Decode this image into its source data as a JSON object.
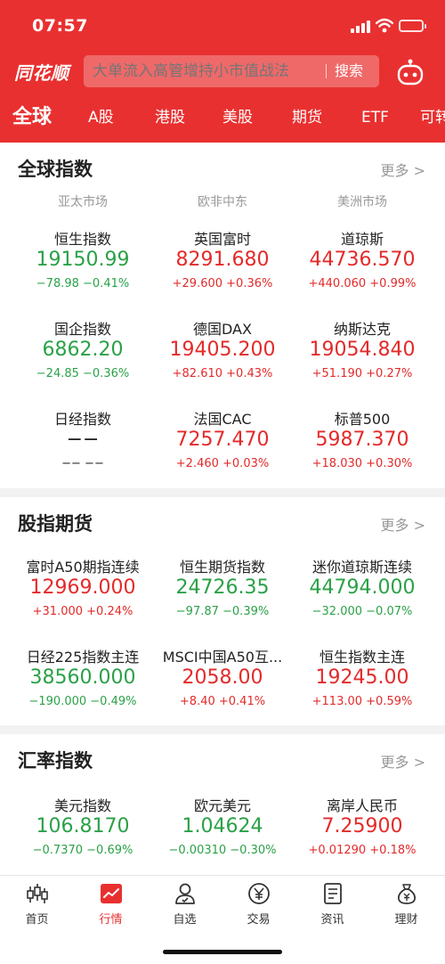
{
  "status": {
    "time": "07:57"
  },
  "header": {
    "logo": "同花顺",
    "search_placeholder": "大单流入高管增持小市值战法",
    "search_button": "搜索"
  },
  "tabs": [
    "全球",
    "A股",
    "港股",
    "美股",
    "期货",
    "ETF",
    "可转"
  ],
  "global": {
    "title": "全球指数",
    "more": "更多",
    "regions": [
      "亚太市场",
      "欧非中东",
      "美洲市场"
    ],
    "items": [
      {
        "name": "恒生指数",
        "price": "19150.99",
        "change": "−78.98  −0.41%",
        "dir": "green"
      },
      {
        "name": "英国富时",
        "price": "8291.680",
        "change": "+29.600  +0.36%",
        "dir": "red"
      },
      {
        "name": "道琼斯",
        "price": "44736.570",
        "change": "+440.060  +0.99%",
        "dir": "red"
      },
      {
        "name": "国企指数",
        "price": "6862.20",
        "change": "−24.85  −0.36%",
        "dir": "green"
      },
      {
        "name": "德国DAX",
        "price": "19405.200",
        "change": "+82.610  +0.43%",
        "dir": "red"
      },
      {
        "name": "纳斯达克",
        "price": "19054.840",
        "change": "+51.190  +0.27%",
        "dir": "red"
      },
      {
        "name": "日经指数",
        "price": "−−",
        "change": "−− −−",
        "dir": "neutral"
      },
      {
        "name": "法国CAC",
        "price": "7257.470",
        "change": "+2.460  +0.03%",
        "dir": "red"
      },
      {
        "name": "标普500",
        "price": "5987.370",
        "change": "+18.030  +0.30%",
        "dir": "red"
      }
    ]
  },
  "futures": {
    "title": "股指期货",
    "more": "更多",
    "items": [
      {
        "name": "富时A50期指连续",
        "price": "12969.000",
        "change": "+31.000  +0.24%",
        "dir": "red"
      },
      {
        "name": "恒生期货指数",
        "price": "24726.35",
        "change": "−97.87  −0.39%",
        "dir": "green"
      },
      {
        "name": "迷你道琼斯连续",
        "price": "44794.000",
        "change": "−32.000  −0.07%",
        "dir": "green"
      },
      {
        "name": "日经225指数主连",
        "price": "38560.000",
        "change": "−190.000  −0.49%",
        "dir": "green"
      },
      {
        "name": "MSCI中国A50互...",
        "price": "2058.00",
        "change": "+8.40  +0.41%",
        "dir": "red"
      },
      {
        "name": "恒生指数主连",
        "price": "19245.00",
        "change": "+113.00  +0.59%",
        "dir": "red"
      }
    ]
  },
  "fx": {
    "title": "汇率指数",
    "more": "更多",
    "items": [
      {
        "name": "美元指数",
        "price": "106.8170",
        "change": "−0.7370  −0.69%",
        "dir": "green"
      },
      {
        "name": "欧元美元",
        "price": "1.04624",
        "change": "−0.00310  −0.30%",
        "dir": "green"
      },
      {
        "name": "离岸人民币",
        "price": "7.25900",
        "change": "+0.01290  +0.18%",
        "dir": "red"
      }
    ]
  },
  "tabbar": [
    {
      "label": "首页",
      "icon": "candlestick-icon"
    },
    {
      "label": "行情",
      "icon": "market-chart-icon",
      "active": true
    },
    {
      "label": "自选",
      "icon": "user-icon"
    },
    {
      "label": "交易",
      "icon": "yuan-icon"
    },
    {
      "label": "资讯",
      "icon": "news-icon"
    },
    {
      "label": "理财",
      "icon": "money-bag-icon"
    }
  ]
}
